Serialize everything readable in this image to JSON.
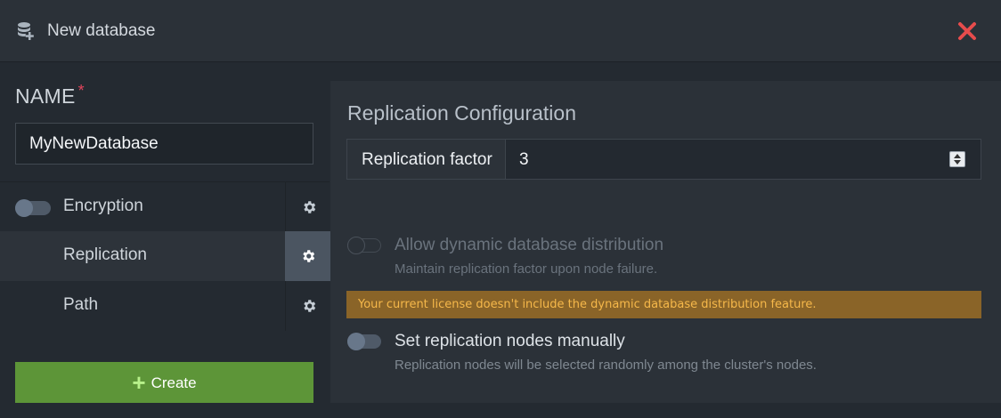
{
  "header": {
    "title": "New database",
    "db_icon": "database-plus-icon",
    "close_icon": "close-icon",
    "close_color": "#e74c4c"
  },
  "form": {
    "name_label": "NAME",
    "required_mark": "*",
    "name_value": "MyNewDatabase"
  },
  "sections": {
    "encryption": {
      "label": "Encryption",
      "enabled": false
    },
    "replication": {
      "label": "Replication",
      "active": true
    },
    "path": {
      "label": "Path"
    }
  },
  "create_button": {
    "label": "Create",
    "icon": "plus-icon",
    "color": "#5d9538"
  },
  "replication_config": {
    "title": "Replication Configuration",
    "factor_label": "Replication factor",
    "factor_value": "3",
    "dynamic": {
      "title": "Allow dynamic database distribution",
      "description": "Maintain replication factor upon node failure.",
      "enabled": false,
      "disabled": true
    },
    "license_warning": "Your current license doesn't include the dynamic database distribution feature.",
    "manual": {
      "title": "Set replication nodes manually",
      "description": "Replication nodes will be selected randomly among the cluster's nodes.",
      "enabled": false
    }
  },
  "colors": {
    "background": "#242a31",
    "panel": "#2b3138",
    "warning_bg": "#8a6428",
    "warning_text": "#f6b84a",
    "required": "#e2445c"
  }
}
